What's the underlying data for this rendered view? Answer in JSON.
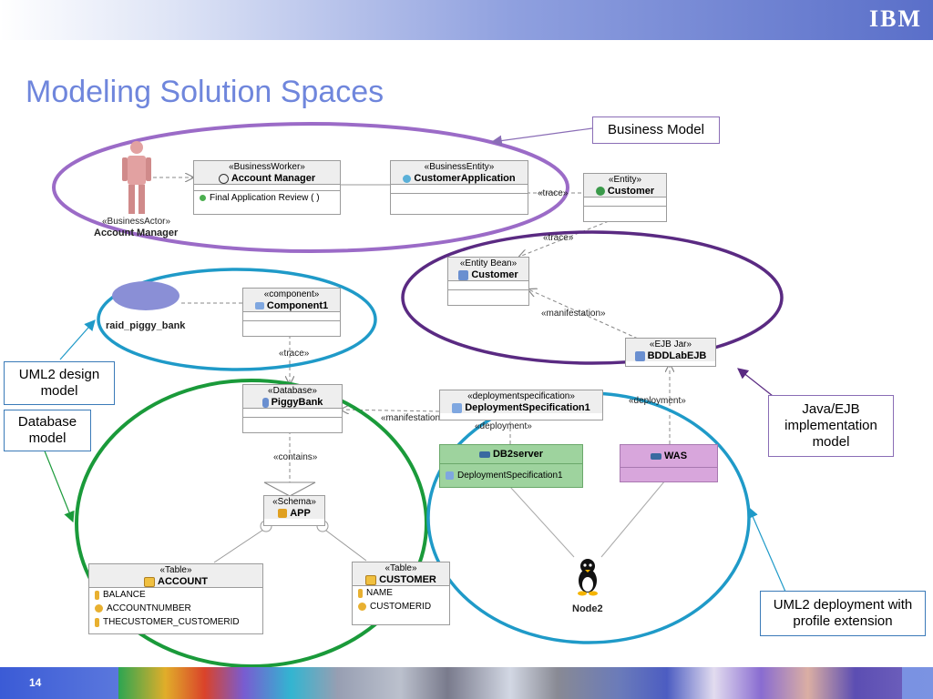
{
  "header": {
    "logo": "IBM"
  },
  "slide": {
    "title": "Modeling Solution Spaces",
    "page_number": "14"
  },
  "callouts": {
    "business_model": "Business Model",
    "uml2_design_model": "UML2 design model",
    "database_model": "Database model",
    "java_ejb_model": "Java/EJB implementation model",
    "uml2_deployment": "UML2 deployment with profile extension"
  },
  "actor": {
    "stereotype": "«BusinessActor»",
    "name": "Account Manager"
  },
  "business_worker": {
    "stereotype": "«BusinessWorker»",
    "name": "Account Manager",
    "operation": "Final Application Review ( )"
  },
  "business_entity": {
    "stereotype": "«BusinessEntity»",
    "name": "CustomerApplication"
  },
  "entity": {
    "stereotype": "«Entity»",
    "name": "Customer"
  },
  "entity_bean": {
    "stereotype": "«Entity Bean»",
    "name": "Customer"
  },
  "ejb_jar": {
    "stereotype": "«EJB Jar»",
    "name": "BDDLabEJB"
  },
  "node_raid": {
    "name": "raid_piggy_bank"
  },
  "component": {
    "stereotype": "«component»",
    "name": "Component1"
  },
  "database": {
    "stereotype": "«Database»",
    "name": "PiggyBank"
  },
  "deployment_spec": {
    "stereotype": "«deploymentspecification»",
    "name": "DeploymentSpecification1"
  },
  "db2server": {
    "name": "DB2server",
    "item": "DeploymentSpecification1"
  },
  "was": {
    "name": "WAS"
  },
  "schema": {
    "stereotype": "«Schema»",
    "name": "APP"
  },
  "table_account": {
    "stereotype": "«Table»",
    "name": "ACCOUNT",
    "columns": [
      "BALANCE",
      "ACCOUNTNUMBER",
      "THECUSTOMER_CUSTOMERID"
    ]
  },
  "table_customer": {
    "stereotype": "«Table»",
    "name": "CUSTOMER",
    "columns": [
      "NAME",
      "CUSTOMERID"
    ]
  },
  "node2": {
    "name": "Node2"
  },
  "connector_labels": {
    "trace": "«trace»",
    "trace_component": "«trace»",
    "trace_bean": "«trace»",
    "manifestation_bean": "«manifestation»",
    "manifestation_db": "«manifestation»",
    "deployment_db2": "«deployment»",
    "deployment_was": "«deployment»",
    "contains": "«contains»"
  },
  "colors": {
    "title": "#6f86dc",
    "purple_ellipse": "#9b6bc7",
    "dark_purple_ellipse": "#5a2a82",
    "blue_ellipse": "#1f9ac8",
    "green_ellipse": "#1a9a3a",
    "db2_fill": "#9ed39e",
    "was_fill": "#d8a6dc"
  }
}
